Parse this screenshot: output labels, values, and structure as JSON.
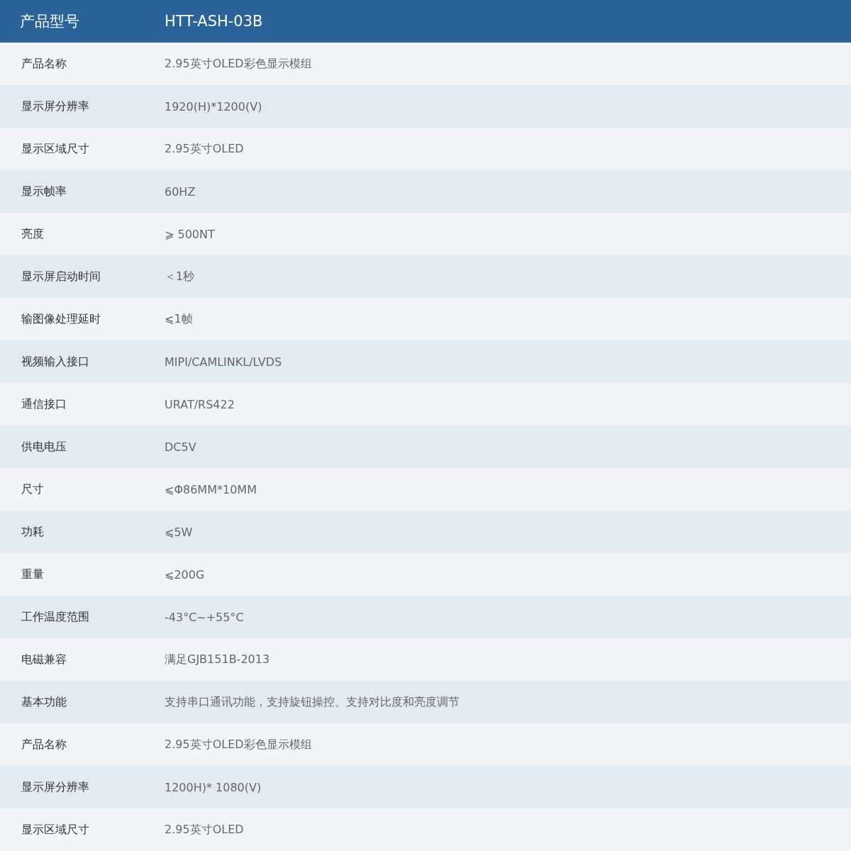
{
  "table": {
    "header": {
      "label": "产品型号",
      "value": "HTT-ASH-03B"
    },
    "rows": [
      {
        "label": "产品名称",
        "value": "2.95英寸OLED彩色显示模组"
      },
      {
        "label": "显示屏分辨率",
        "value": "1920(H)*1200(V)"
      },
      {
        "label": "显示区域尺寸",
        "value": "2.95英寸OLED"
      },
      {
        "label": "显示帧率",
        "value": "60HZ"
      },
      {
        "label": "亮度",
        "value": "⩾ 500NT"
      },
      {
        "label": "显示屏启动时间",
        "value": "＜1秒"
      },
      {
        "label": "输图像处理延时",
        "value": "⩽1帧"
      },
      {
        "label": "视频输入接口",
        "value": "MIPI/CAMLINKL/LVDS"
      },
      {
        "label": "通信接口",
        "value": "URAT/RS422"
      },
      {
        "label": "供电电压",
        "value": "DC5V"
      },
      {
        "label": "尺寸",
        "value": "⩽Φ86MM*10MM"
      },
      {
        "label": "功耗",
        "value": "⩽5W"
      },
      {
        "label": "重量",
        "value": "⩽200G"
      },
      {
        "label": "工作温度范围",
        "value": "-43°C~+55°C"
      },
      {
        "label": "电磁兼容",
        "value": "满足GJB151B-2013"
      },
      {
        "label": "基本功能",
        "value": "支持串口通讯功能，支持旋钮操控、支持对比度和亮度调节"
      },
      {
        "label": "产品名称",
        "value": "2.95英寸OLED彩色显示模组"
      },
      {
        "label": "显示屏分辨率",
        "value": "1200H)* 1080(V)"
      },
      {
        "label": "显示区域尺寸",
        "value": "2.95英寸OLED"
      }
    ]
  }
}
